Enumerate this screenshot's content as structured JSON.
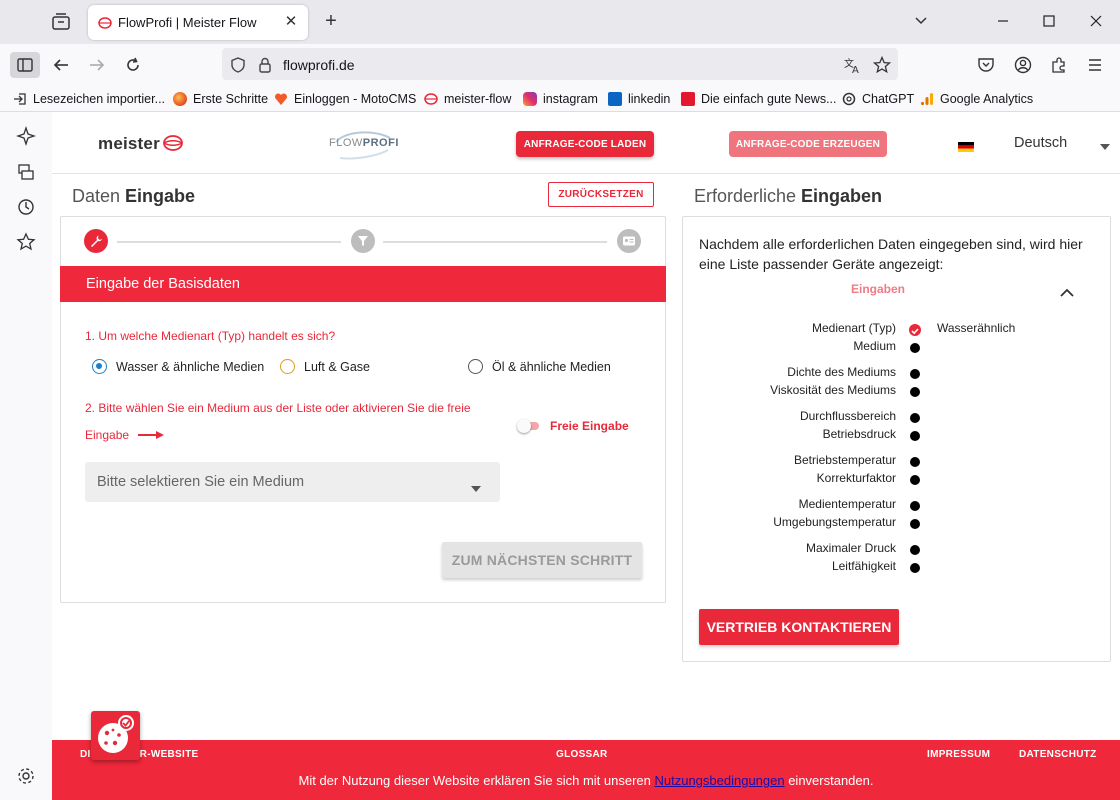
{
  "browser": {
    "tab_title": "FlowProfi | Meister Flow",
    "url": "flowprofi.de",
    "bookmarks": [
      "Lesezeichen importier...",
      "Erste Schritte",
      "Einloggen - MotoCMS",
      "meister-flow",
      "instagram",
      "linkedin",
      "Die einfach gute News...",
      "ChatGPT",
      "Google Analytics"
    ]
  },
  "header": {
    "logo_text": "meister",
    "flow_logo_a": "FLOW",
    "flow_logo_b": "PROFI",
    "load_code": "ANFRAGE-CODE LADEN",
    "generate_code": "ANFRAGE-CODE ERZEUGEN",
    "language": "Deutsch"
  },
  "left": {
    "title_a": "Daten ",
    "title_b": "Eingabe",
    "reset": "ZURÜCKSETZEN",
    "band": "Eingabe der Basisdaten",
    "q1": "1. Um welche Medienart (Typ) handelt es sich?",
    "radios": [
      "Wasser & ähnliche Medien",
      "Luft & Gase",
      "Öl & ähnliche Medien"
    ],
    "q2_line1": "2. Bitte wählen Sie ein Medium aus der Liste oder aktivieren Sie die freie",
    "q2_line2": "Eingabe",
    "toggle_label": "Freie Eingabe",
    "select_placeholder": "Bitte selektieren Sie ein Medium",
    "next": "ZUM NÄCHSTEN SCHRITT"
  },
  "right": {
    "title_a": "Erforderliche ",
    "title_b": "Eingaben",
    "info": "Nachdem alle erforderlichen Daten eingegeben sind, wird hier eine Liste passender Geräte angezeigt:",
    "accordion": "Eingaben",
    "requirements": [
      {
        "label": "Medienart (Typ)",
        "done": true,
        "value": "Wasserähnlich"
      },
      {
        "label": "Medium",
        "done": false,
        "value": ""
      },
      {
        "label": "Dichte des Mediums",
        "done": false,
        "value": ""
      },
      {
        "label": "Viskosität des Mediums",
        "done": false,
        "value": ""
      },
      {
        "label": "Durchflussbereich",
        "done": false,
        "value": ""
      },
      {
        "label": "Betriebsdruck",
        "done": false,
        "value": ""
      },
      {
        "label": "Betriebstemperatur",
        "done": false,
        "value": ""
      },
      {
        "label": "Korrekturfaktor",
        "done": false,
        "value": ""
      },
      {
        "label": "Medientemperatur",
        "done": false,
        "value": ""
      },
      {
        "label": "Umgebungstemperatur",
        "done": false,
        "value": ""
      },
      {
        "label": "Maximaler Druck",
        "done": false,
        "value": ""
      },
      {
        "label": "Leitfähigkeit",
        "done": false,
        "value": ""
      }
    ],
    "contact": "VERTRIEB KONTAKTIEREN"
  },
  "footer": {
    "link_website": "DIE MEISTER-WEBSITE",
    "link_glossar": "GLOSSAR",
    "link_impressum": "IMPRESSUM",
    "link_datenschutz": "DATENSCHUTZ",
    "consent_before": "Mit der Nutzung dieser Website erklären Sie sich mit unseren ",
    "consent_link": "Nutzungsbedingungen",
    "consent_after": " einverstanden."
  },
  "colors": {
    "brand_red": "#e9283a",
    "band_red": "#f0283b",
    "light_red": "#f0747e",
    "radio_blue": "#1e7fc8",
    "radio_orange": "#e39a1a"
  }
}
